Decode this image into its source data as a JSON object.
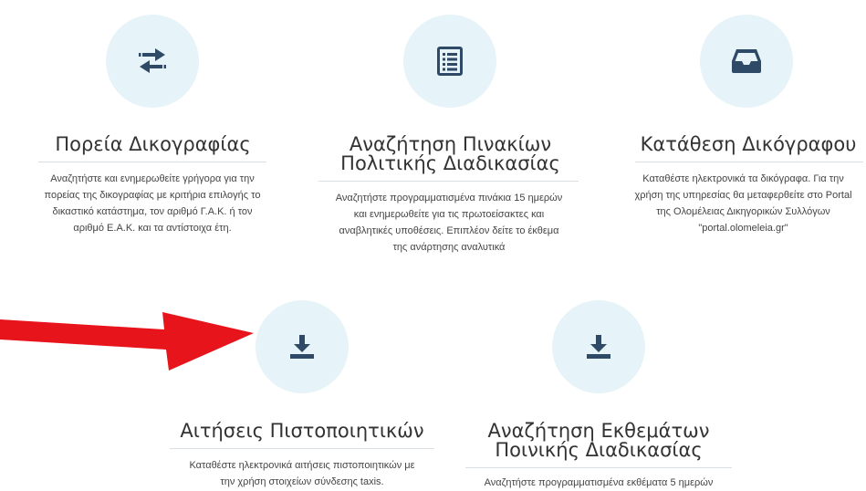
{
  "colors": {
    "circle_bg": "#e6f3f8",
    "icon": "#2f4a66",
    "arrow": "#e8141b",
    "text": "#333333"
  },
  "cards": [
    {
      "icon": "exchange-arrows-icon",
      "title": "Πορεία Δικογραφίας",
      "desc_lines": [
        "Αναζητήστε και ενημερωθείτε γρήγορα για την",
        "πορείας της δικογραφίας με κριτήρια επιλογής το",
        "δικαστικό κατάστημα, τον αριθμό Γ.Α.Κ. ή τον",
        "αριθμό Ε.Α.Κ. και τα αντίστοιχα έτη."
      ]
    },
    {
      "icon": "list-document-icon",
      "title_lines": [
        "Αναζήτηση Πινακίων",
        "Πολιτικής Διαδικασίας"
      ],
      "desc_lines": [
        "Αναζητήστε προγραμματισμένα πινάκια 15 ημερών",
        "και ενημερωθείτε για τις πρωτοείσακτες και",
        "αναβλητικές υποθέσεις. Επιπλέον δείτε το έκθεμα",
        "της ανάρτησης αναλυτικά"
      ]
    },
    {
      "icon": "inbox-tray-icon",
      "title": "Κατάθεση Δικόγραφου",
      "desc_lines": [
        "Καταθέστε ηλεκτρονικά τα δικόγραφα. Για την",
        "χρήση της υπηρεσίας θα μεταφερθείτε στο Portal",
        "της Ολομέλειας Δικηγορικών Συλλόγων",
        "\"portal.olomeleia.gr\""
      ]
    },
    {
      "icon": "download-icon",
      "title": "Αιτήσεις Πιστοποιητικών",
      "desc_lines": [
        "Καταθέστε ηλεκτρονικά αιτήσεις πιστοποιητικών με",
        "την χρήση στοιχείων σύνδεσης taxis."
      ]
    },
    {
      "icon": "download-icon",
      "title_lines": [
        "Αναζήτηση Εκθεμάτων",
        "Ποινικής Διαδικασίας"
      ],
      "desc_lines": [
        "Αναζητήστε προγραμματισμένα εκθέματα 5 ημερών"
      ]
    }
  ]
}
